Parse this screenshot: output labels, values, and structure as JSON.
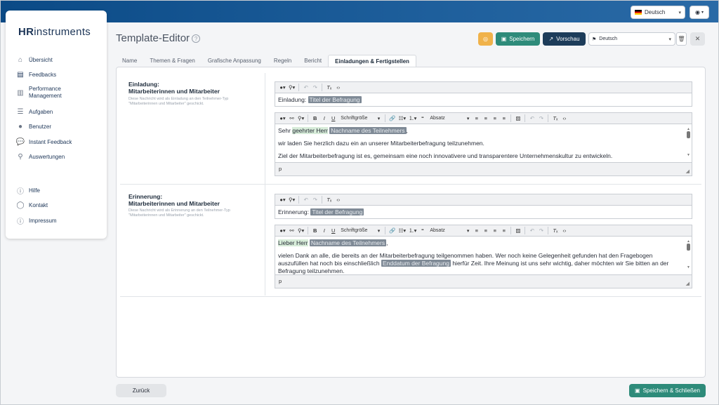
{
  "topbar": {
    "language": "Deutsch"
  },
  "sidebar": {
    "logo_a": "HR",
    "logo_b": "instruments",
    "items": [
      {
        "label": "Übersicht",
        "icon": "home-icon"
      },
      {
        "label": "Feedbacks",
        "icon": "clipboard-icon"
      },
      {
        "label": "Performance Management",
        "icon": "bar-chart-icon"
      },
      {
        "label": "Aufgaben",
        "icon": "task-list-icon"
      },
      {
        "label": "Benutzer",
        "icon": "user-icon"
      },
      {
        "label": "Instant Feedback",
        "icon": "chat-bubble-icon"
      },
      {
        "label": "Auswertungen",
        "icon": "analytics-icon"
      }
    ],
    "footer_items": [
      {
        "label": "Hilfe",
        "icon": "question-circle-icon"
      },
      {
        "label": "Kontakt",
        "icon": "speech-bubble-icon"
      },
      {
        "label": "Impressum",
        "icon": "info-circle-icon"
      }
    ]
  },
  "header": {
    "title": "Template-Editor",
    "save_label": "Speichern",
    "preview_label": "Vorschau",
    "language": "Deutsch",
    "accent_save": "#2e8b7a",
    "accent_preview": "#1d3c5a",
    "accent_warn": "#f0b24a"
  },
  "tabs": [
    {
      "label": "Name"
    },
    {
      "label": "Themen & Fragen"
    },
    {
      "label": "Grafische Anpassung"
    },
    {
      "label": "Regeln"
    },
    {
      "label": "Bericht"
    },
    {
      "label": "Einladungen & Fertigstellen",
      "active": true
    }
  ],
  "invitation": {
    "title_line1": "Einladung:",
    "title_line2": "Mitarbeiterinnen und Mitarbeiter",
    "desc": "Diese Nachricht wird als Einladung an den Teilnehmer-Typ \"Mitarbeiterinnen und Mitarbeiter\" geschickt.",
    "subject_prefix": "Einladung:",
    "subject_placeholder": "Titel der Befragung",
    "body_greeting_a": "Sehr",
    "body_greeting_b": "geehrter Herr",
    "body_name_placeholder": "Nachname des Teilnehmers",
    "body_line2": "wir laden Sie herzlich dazu ein an unserer Mitarbeiterbefragung teilzunehmen.",
    "body_line3": "Ziel der Mitarbeiterbefragung ist es, gemeinsam eine noch innovativere und transparentere Unternehmenskultur zu entwickeln.",
    "status_path": "p"
  },
  "reminder": {
    "title_line1": "Erinnerung:",
    "title_line2": "Mitarbeiterinnen und Mitarbeiter",
    "desc": "Diese Nachricht wird als Erinnerung an den Teilnehmer-Typ \"Mitarbeiterinnen und Mitarbeiter\" geschickt.",
    "subject_prefix": "Erinnerung:",
    "subject_placeholder": "Titel der Befragung",
    "body_greeting": "Lieber Herr",
    "body_name_placeholder": "Nachname des Teilnehmers",
    "body_line2a": "vielen Dank an alle, die bereits an der Mitarbeiterbefragung teilgenommen haben. Wer noch keine Gelegenheit gefunden hat den Fragebogen auszufüllen hat noch bis einschließlich",
    "body_date_placeholder": "Enddatum der Befragung",
    "body_line2b": "hierfür Zeit. Ihre Meinung ist uns sehr wichtig, daher möchten wir Sie bitten an der Befragung teilzunehmen.",
    "status_path": "p"
  },
  "toolbar": {
    "font_size_label": "Schriftgröße",
    "format_label": "Absatz",
    "bold": "B",
    "italic": "I",
    "underline": "U"
  },
  "footer": {
    "back_label": "Zurück",
    "save_close_label": "Speichern & Schließen"
  }
}
